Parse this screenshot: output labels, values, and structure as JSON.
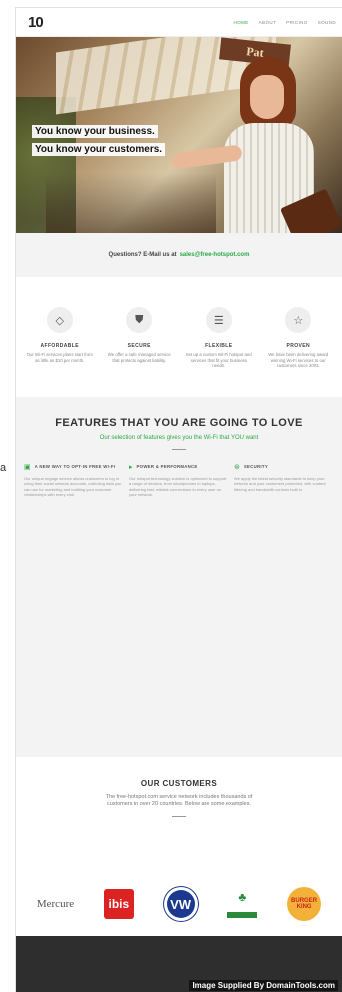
{
  "side_label": "a",
  "header": {
    "logo_num": "10",
    "logo_sub": "",
    "nav": [
      "HOME",
      "ABOUT",
      "PRICING",
      "SOUND"
    ]
  },
  "hero": {
    "line1": "You know your business.",
    "line2": "You know your customers.",
    "sign_text": "Pat"
  },
  "contact": {
    "text": "Questions? E-Mail us at",
    "email": "sales@free-hotspot.com"
  },
  "benefits": [
    {
      "icon": "tag-icon",
      "title": "AFFORDABLE",
      "text": "Our Wi-Fi services plans start from as little as $10 per month."
    },
    {
      "icon": "shield-icon",
      "title": "SECURE",
      "text": "We offer a safe managed service that protects against liability."
    },
    {
      "icon": "sliders-icon",
      "title": "FLEXIBLE",
      "text": "Set up a custom Wi-Fi hotspot and services that fit your business needs."
    },
    {
      "icon": "star-icon",
      "title": "PROVEN",
      "text": "We have been delivering award winning Wi-Fi services to our customers since 2003."
    }
  ],
  "features": {
    "title": "FEATURES THAT YOU ARE GOING TO LOVE",
    "subtitle": "Our selection of features gives you the Wi-Fi that YOU want",
    "cols": [
      {
        "title": "A NEW WAY TO OPT-IN FREE WI-FI",
        "text": "Our unique engage service allows customers to log in using their social network accounts, collecting data you can use for marketing and building your customer relationships with every visit."
      },
      {
        "title": "POWER & PERFORMANCE",
        "text": "Our hotspot technology solution is optimized to support a range of devices, from smartphones to laptops, delivering fast, reliable connections to every user on your network."
      },
      {
        "title": "SECURITY",
        "text": "We apply the latest security standards to keep your network and your customers protected, with content filtering and bandwidth controls built in."
      }
    ]
  },
  "customers": {
    "title": "OUR CUSTOMERS",
    "desc": "The free-hotspot.com service network includes thousands of customers in over 20 countries. Below are some examples.",
    "logos": [
      {
        "name": "mercure",
        "text": "Mercure"
      },
      {
        "name": "ibis",
        "text": "ibis"
      },
      {
        "name": "volkswagen",
        "text": "VW"
      },
      {
        "name": "green-brand",
        "text": "♣"
      },
      {
        "name": "burger-king",
        "text": "BURGER KING"
      }
    ]
  },
  "footer": {
    "line1": "",
    "line2": ""
  },
  "watermark": "Image Supplied By DomainTools.com"
}
